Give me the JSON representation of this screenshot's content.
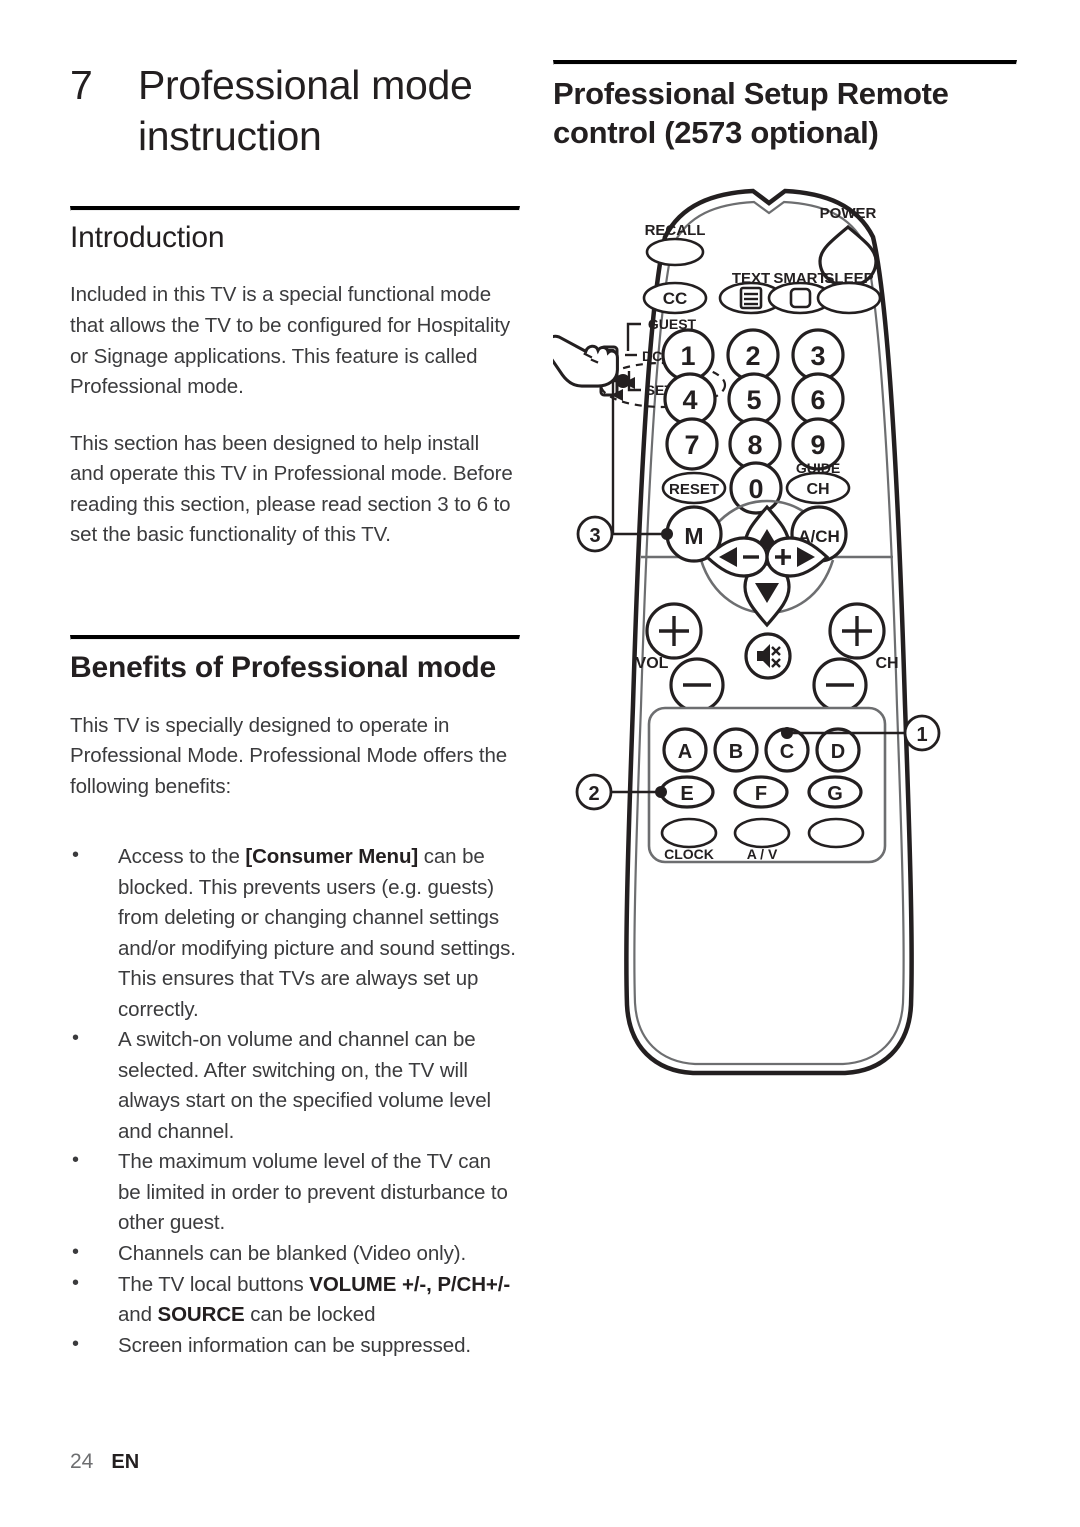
{
  "page": {
    "chapter_number": "7",
    "chapter_title": "Professional mode instruction",
    "footer_page": "24",
    "footer_lang": "EN"
  },
  "left_column": {
    "intro_heading": "Introduction",
    "intro_paragraph_1": "Included in this TV is a special functional mode that allows the TV to be configured for Hospitality or Signage applications. This feature is called Professional mode.",
    "intro_paragraph_2": "This section has been designed to help install and operate this TV in Professional mode. Before reading this section, please read section 3 to 6 to set the basic functionality of this TV.",
    "benefits_heading": "Benefits of Professional mode",
    "benefits_paragraph": "This TV is specially designed to operate in Professional Mode. Professional Mode offers the following benefits:",
    "bullets": [
      {
        "pre": "Access to the ",
        "bold": "[Consumer Menu]",
        "post": " can be blocked.  This prevents users (e.g. guests) from deleting or changing channel settings and/or modifying picture and sound settings. This ensures that TVs are always set up correctly."
      },
      {
        "pre": "A switch-on volume and channel can be selected.  After switching on, the TV will always start on the specified volume level and channel.",
        "bold": "",
        "post": ""
      },
      {
        "pre": "The maximum volume level of the TV can be limited in order to prevent disturbance to other guest.",
        "bold": "",
        "post": ""
      },
      {
        "pre": "Channels can be blanked (Video only).",
        "bold": "",
        "post": ""
      },
      {
        "pre": "The TV local buttons ",
        "bold": "VOLUME +/-, P/CH+/-",
        "post": " and ",
        "bold2": "SOURCE",
        "post2": " can be locked"
      },
      {
        "pre": "Screen information can be suppressed.",
        "bold": "",
        "post": ""
      }
    ]
  },
  "right_column": {
    "heading": "Professional Setup Remote control (2573 optional)"
  },
  "remote": {
    "labels": {
      "recall": "RECALL",
      "power": "POWER",
      "cc": "CC",
      "text": "TEXT",
      "smart": "SMART",
      "sleep": "SLEEP",
      "guest": "GUEST",
      "dcm": "DCM",
      "setup": "SETUP",
      "reset": "RESET",
      "guide": "GUIDE",
      "ch_guide": "CH",
      "menu": "M",
      "ach": "A/CH",
      "vol": "VOL",
      "ch": "CH",
      "clock": "CLOCK",
      "av": "A / V"
    },
    "keypad": [
      "1",
      "2",
      "3",
      "4",
      "5",
      "6",
      "7",
      "8",
      "9",
      "0"
    ],
    "color_keys": [
      "A",
      "B",
      "C",
      "D",
      "E",
      "F",
      "G"
    ],
    "nav": {
      "up": "▲",
      "down": "▼",
      "left_minus": "◄−",
      "right_plus": "+►",
      "vol_plus": "+",
      "vol_minus": "−",
      "ch_plus": "+",
      "ch_minus": "−"
    },
    "callouts": [
      "1",
      "2",
      "3"
    ],
    "colors": {
      "outline": "#231f20",
      "inner": "#6d6e70",
      "fill": "#ffffff"
    }
  }
}
